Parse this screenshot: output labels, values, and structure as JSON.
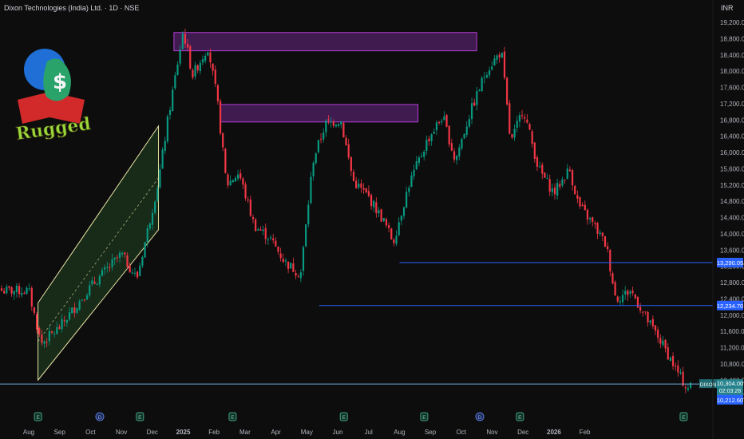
{
  "header": {
    "title": "Dixon Technologies (India) Ltd. · 1D · NSE",
    "currency": "INR"
  },
  "logo": {
    "text": "Rugged",
    "symbol": "$"
  },
  "colors": {
    "background": "#0d0d0d",
    "up": "#089981",
    "down": "#f23645",
    "zone_border": "#b13bd4",
    "zone_fill": "#4a1f5c",
    "level_line": "#2962ff",
    "channel": "#e8e3a5",
    "axis_text": "#b2b5be"
  },
  "chart_data": {
    "type": "candlestick",
    "symbol": "DIXON",
    "x_ticks": [
      "Aug",
      "Sep",
      "Oct",
      "Nov",
      "Dec",
      "2025",
      "Feb",
      "Mar",
      "Apr",
      "May",
      "Jun",
      "Jul",
      "Aug",
      "Sep",
      "Oct",
      "Nov",
      "Dec",
      "2026",
      "Feb"
    ],
    "y_ticks": [
      "9,600.00",
      "10,000.00",
      "10,400.00",
      "10,800.00",
      "11,200.00",
      "11,600.00",
      "12,000.00",
      "12,400.00",
      "12,800.00",
      "13,200.00",
      "13,600.00",
      "14,000.00",
      "14,400.00",
      "14,800.00",
      "15,200.00",
      "15,600.00",
      "16,000.00",
      "16,400.00",
      "16,800.00",
      "17,200.00",
      "17,600.00",
      "18,000.00",
      "18,400.00",
      "18,800.00",
      "19,200.00"
    ],
    "ylim": [
      9600,
      19200
    ],
    "path": [
      {
        "m": 0,
        "p": 12600
      },
      {
        "m": 0.4,
        "p": 11300
      },
      {
        "m": 1.0,
        "p": 11700
      },
      {
        "m": 2.0,
        "p": 12700
      },
      {
        "m": 3.0,
        "p": 13500
      },
      {
        "m": 3.5,
        "p": 12900
      },
      {
        "m": 4.2,
        "p": 15300
      },
      {
        "m": 4.5,
        "p": 16800
      },
      {
        "m": 5.0,
        "p": 19000
      },
      {
        "m": 5.3,
        "p": 17900
      },
      {
        "m": 5.8,
        "p": 18600
      },
      {
        "m": 6.1,
        "p": 17300
      },
      {
        "m": 6.4,
        "p": 15200
      },
      {
        "m": 6.8,
        "p": 15500
      },
      {
        "m": 7.3,
        "p": 14200
      },
      {
        "m": 7.8,
        "p": 13900
      },
      {
        "m": 8.3,
        "p": 13300
      },
      {
        "m": 8.8,
        "p": 13000
      },
      {
        "m": 9.2,
        "p": 15800
      },
      {
        "m": 9.6,
        "p": 16700
      },
      {
        "m": 10.1,
        "p": 16800
      },
      {
        "m": 10.5,
        "p": 15300
      },
      {
        "m": 11.0,
        "p": 14900
      },
      {
        "m": 11.5,
        "p": 14300
      },
      {
        "m": 11.8,
        "p": 13800
      },
      {
        "m": 12.3,
        "p": 15200
      },
      {
        "m": 12.9,
        "p": 16300
      },
      {
        "m": 13.4,
        "p": 16900
      },
      {
        "m": 13.8,
        "p": 15800
      },
      {
        "m": 14.3,
        "p": 17000
      },
      {
        "m": 14.8,
        "p": 18000
      },
      {
        "m": 15.3,
        "p": 18500
      },
      {
        "m": 15.6,
        "p": 16200
      },
      {
        "m": 16.0,
        "p": 17100
      },
      {
        "m": 16.5,
        "p": 15600
      },
      {
        "m": 17.0,
        "p": 15000
      },
      {
        "m": 17.5,
        "p": 15600
      },
      {
        "m": 17.8,
        "p": 14700
      },
      {
        "m": 18.3,
        "p": 14200
      },
      {
        "m": 18.7,
        "p": 13700
      },
      {
        "m": 19.0,
        "p": 12400
      },
      {
        "m": 19.5,
        "p": 12600
      },
      {
        "m": 20.0,
        "p": 11900
      },
      {
        "m": 20.5,
        "p": 11300
      },
      {
        "m": 21.0,
        "p": 10600
      },
      {
        "m": 21.3,
        "p": 10200
      },
      {
        "m": 21.5,
        "p": 10304
      }
    ],
    "zones": [
      {
        "m_start": 4.7,
        "m_end": 14.5,
        "low": 18500,
        "high": 18950
      },
      {
        "m_start": 6.2,
        "m_end": 12.6,
        "low": 16750,
        "high": 17180
      }
    ],
    "levels": [
      {
        "value": 13290.05,
        "label": "13,290.05",
        "m_start": 12.0
      },
      {
        "value": 12234.7,
        "label": "12,234.70",
        "m_start": 9.4
      },
      {
        "value": 10304.0,
        "label": "10,304.00",
        "m_start": 0
      }
    ],
    "channel": {
      "lower": [
        [
          0.3,
          10400
        ],
        [
          4.2,
          14100
        ]
      ],
      "upper": [
        [
          0.3,
          12300
        ],
        [
          4.2,
          16650
        ]
      ]
    },
    "last": {
      "symbol": "DIXON",
      "price": "10,304.00",
      "countdown": "02:03:28",
      "low_label": "10,212.60"
    },
    "events": [
      {
        "m": 0.3,
        "t": "E"
      },
      {
        "m": 2.3,
        "t": "D"
      },
      {
        "m": 3.6,
        "t": "E"
      },
      {
        "m": 6.6,
        "t": "E"
      },
      {
        "m": 10.2,
        "t": "E"
      },
      {
        "m": 12.8,
        "t": "E"
      },
      {
        "m": 14.6,
        "t": "D"
      },
      {
        "m": 15.9,
        "t": "E"
      },
      {
        "m": 21.2,
        "t": "E"
      }
    ]
  }
}
